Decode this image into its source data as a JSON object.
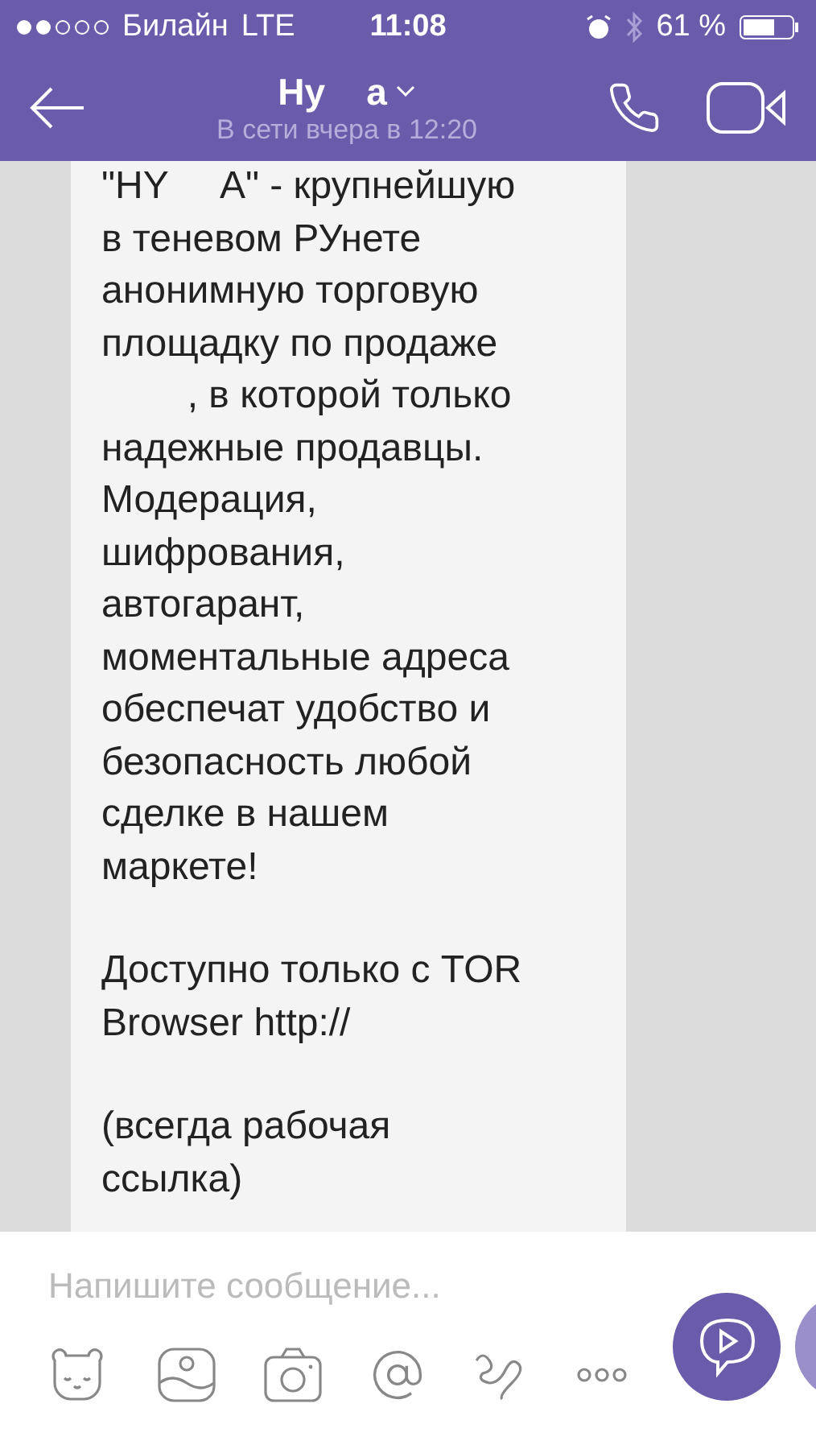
{
  "status_bar": {
    "carrier": "Билайн",
    "network": "LTE",
    "time": "11:08",
    "battery": "61 %"
  },
  "header": {
    "title": "Ну    а",
    "subtitle": "В сети вчера в 12:20"
  },
  "message": {
    "paragraphs": [
      [
        "\"HY     A\" - крупнейшую",
        "в теневом РУнете",
        "анонимную торговую",
        "площадку по продаже",
        "        , в которой только",
        "надежные продавцы.",
        "Модерация,",
        "шифрования,",
        "автогарант,",
        "моментальные адреса",
        "обеспечат удобство и",
        "безопасность любой",
        "сделке в нашем",
        "маркете!"
      ],
      [
        "Доступно только с TOR",
        "Browser http://"
      ],
      [
        "(всегда рабочая",
        "ссылка)"
      ]
    ]
  },
  "composer": {
    "placeholder": "Напишите сообщение..."
  }
}
